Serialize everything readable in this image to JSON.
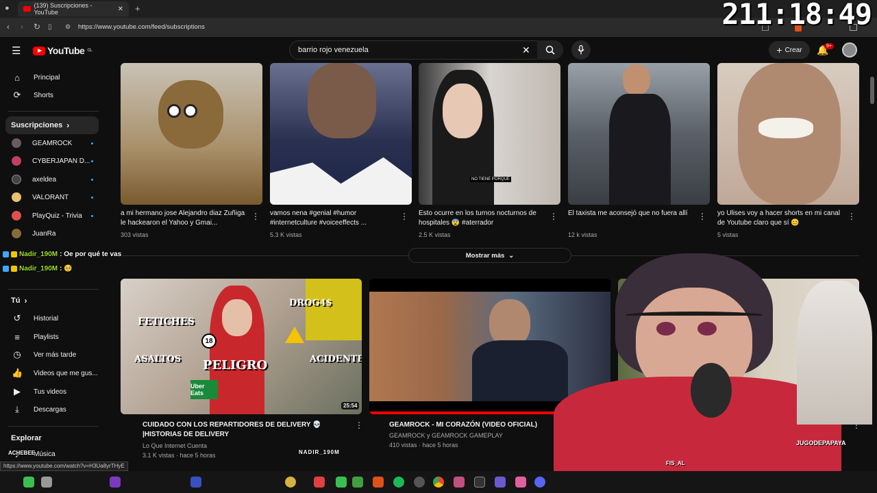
{
  "browser": {
    "tab_title": "(139) Suscripciones - YouTube",
    "url": "https://www.youtube.com/feed/subscriptions",
    "status_url": "https://www.youtube.com/watch?v=H3Ua8yrTHyE"
  },
  "overlay": {
    "clock": "211:18:49",
    "chat": [
      {
        "user": "Nadir_190M",
        "message": ": Oe por qué te vas"
      },
      {
        "user": "Nadir_190M",
        "message": ": 🥺"
      }
    ],
    "watermark_left": "ACHEBEE",
    "watermark_mid": "NADIR_190M",
    "webcam_tag_left": "FIS_AL",
    "webcam_tag_right": "JUGODEPAPAYA"
  },
  "header": {
    "logo": "YouTube",
    "logo_region": "CL",
    "search_value": "barrio rojo venezuela",
    "create_label": "Crear",
    "notification_count": "9+"
  },
  "sidebar": {
    "top_items": [
      {
        "label": "Principal",
        "icon": "home-icon"
      },
      {
        "label": "Shorts",
        "icon": "shorts-icon"
      }
    ],
    "subscriptions_header": "Suscripciones",
    "subscriptions": [
      {
        "name": "GEAMROCK",
        "color": "#6b5b5b"
      },
      {
        "name": "CYBERJAPAN D...",
        "color": "#c04060"
      },
      {
        "name": "axeldea",
        "color": "#444444"
      },
      {
        "name": "VALORANT",
        "color": "#e8c070"
      },
      {
        "name": "PlayQuiz - Trivia",
        "color": "#e05050"
      },
      {
        "name": "JuanRa",
        "color": "#8a6a3a"
      }
    ],
    "you_header": "Tú",
    "you_items": [
      {
        "label": "Historial",
        "icon": "history-icon"
      },
      {
        "label": "Playlists",
        "icon": "playlists-icon"
      },
      {
        "label": "Ver más tarde",
        "icon": "clock-icon"
      },
      {
        "label": "Videos que me gus...",
        "icon": "thumbs-up-icon"
      },
      {
        "label": "Tus videos",
        "icon": "play-square-icon"
      },
      {
        "label": "Descargas",
        "icon": "download-icon"
      }
    ],
    "explore_header": "Explorar",
    "explore_items": [
      {
        "label": "Música"
      }
    ]
  },
  "shorts": [
    {
      "title": "a mi hermano jose Alejandro diaz Zuñiga le hackearon el Yahoo y Gmai...",
      "views": "303 vistas",
      "color": "#b8b0a4"
    },
    {
      "title": "vamos nena #genial #humor #internetculture #voiceeffects ...",
      "views": "5.3 K vistas",
      "color": "#3a3f55"
    },
    {
      "title": "Esto ocurre en los turnos nocturnos de hospitales 😨 #aterrador",
      "views": "2.5 K vistas",
      "color": "#d4d0cc",
      "caption": "NO TIENE PORQUE"
    },
    {
      "title": "El taxista me aconsejó que no fuera allí",
      "views": "12 k vistas",
      "color": "#5e6670"
    },
    {
      "title": "yo Ulises voy a hacer shorts en mi canal de Youtube claro que sí 😊",
      "views": "5 vistas",
      "color": "#c8b8a8"
    }
  ],
  "show_more_label": "Mostrar más",
  "videos": [
    {
      "title": "CUIDADO CON LOS REPARTIDORES DE DELIVERY 💀 |HISTORIAS DE DELIVERY",
      "channel": "Lo Que Internet Cuenta",
      "meta": "3.1 K vistas · hace 5 horas",
      "duration": "25:54",
      "thumb_text": [
        "FETICHES",
        "DROG4$",
        "ASALTOS",
        "PELIGRO",
        "ACIDENTES",
        "Uber Eats",
        "18"
      ]
    },
    {
      "title": "GEAMROCK - MI CORAZÓN (VIDEO OFICIAL)",
      "channel": "GEAMROCK y GEAMROCK GAMEPLAY",
      "meta": "410 vistas · hace 5 horas",
      "duration": ""
    }
  ]
}
